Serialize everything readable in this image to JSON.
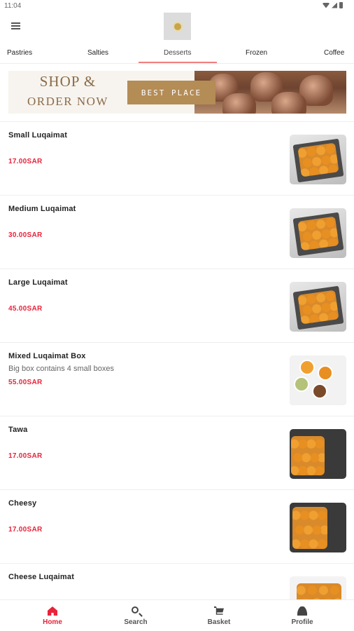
{
  "status_bar": {
    "time": "11:04"
  },
  "tabs": [
    {
      "label": "Pastries"
    },
    {
      "label": "Salties"
    },
    {
      "label": "Desserts"
    },
    {
      "label": "Frozen"
    },
    {
      "label": "Coffee"
    }
  ],
  "active_tab": "Desserts",
  "banner": {
    "line1": "SHOP &",
    "line2": "ORDER NOW",
    "button_label": "BEST PLACE"
  },
  "products": [
    {
      "name": "Small Luqaimat",
      "description": "",
      "price": "17.00SAR"
    },
    {
      "name": "Medium Luqaimat",
      "description": "",
      "price": "30.00SAR"
    },
    {
      "name": "Large Luqaimat",
      "description": "",
      "price": "45.00SAR"
    },
    {
      "name": "Mixed Luqaimat Box",
      "description": "Big box contains 4 small boxes",
      "price": "55.00SAR"
    },
    {
      "name": "Tawa",
      "description": "",
      "price": "17.00SAR"
    },
    {
      "name": "Cheesy",
      "description": "",
      "price": "17.00SAR"
    },
    {
      "name": "Cheese Luqaimat",
      "description": "",
      "price": ""
    }
  ],
  "bottom_nav": [
    {
      "label": "Home",
      "icon": "home-icon"
    },
    {
      "label": "Search",
      "icon": "search-icon"
    },
    {
      "label": "Basket",
      "icon": "basket-icon"
    },
    {
      "label": "Profile",
      "icon": "profile-icon"
    }
  ],
  "colors": {
    "accent": "#e8233a",
    "banner_gold": "#b48c55",
    "tab_indicator": "#f08080"
  }
}
